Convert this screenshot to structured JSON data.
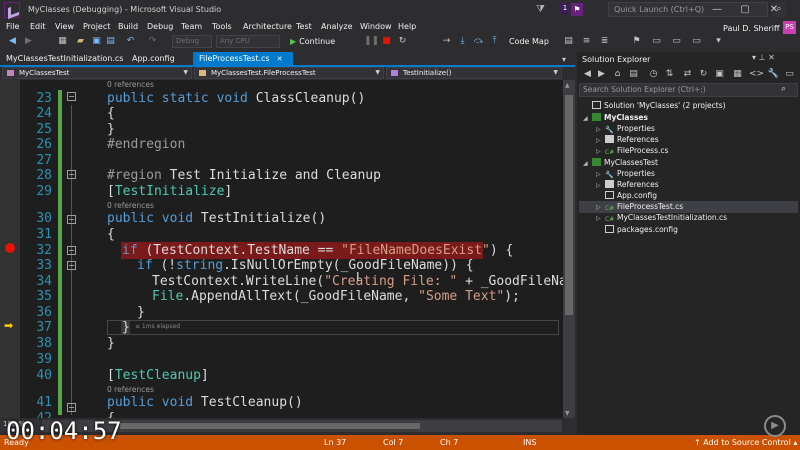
{
  "window": {
    "title": "MyClasses (Debugging) - Microsoft Visual Studio",
    "notification_count": "1",
    "quick_launch_placeholder": "Quick Launch (Ctrl+Q)",
    "user_name": "Paul D. Sheriff",
    "user_initials": "PS"
  },
  "menu": [
    "File",
    "Edit",
    "View",
    "Project",
    "Build",
    "Debug",
    "Team",
    "Tools",
    "Architecture",
    "Test",
    "Analyze",
    "Window",
    "Help"
  ],
  "toolbar": {
    "config_combo": "Debug",
    "platform_combo": "Any CPU",
    "continue_label": "Continue",
    "codemap_label": "Code Map"
  },
  "tabs": [
    {
      "label": "MyClassesTestInitialization.cs"
    },
    {
      "label": "App.config"
    },
    {
      "label": "FileProcessTest.cs",
      "active": true
    }
  ],
  "navbar": {
    "project": "MyClassesTest",
    "class": "MyClassesTest.FileProcessTest",
    "member": "TestInitialize()"
  },
  "editor": {
    "lens_refs": "0 references",
    "elapsed": "≤ 1ms elapsed",
    "line_numbers": [
      "23",
      "24",
      "25",
      "26",
      "27",
      "28",
      "29",
      "30",
      "31",
      "32",
      "33",
      "34",
      "35",
      "36",
      "37",
      "38",
      "39",
      "40",
      "41",
      "42"
    ],
    "lines": {
      "l23": {
        "kw": "public static void ",
        "rest": "ClassCleanup()"
      },
      "l24": "{",
      "l25": "}",
      "l26": "#endregion",
      "l28_kw": "#region",
      "l28_rest": " Test Initialize and Cleanup",
      "l29_open": "[",
      "l29_ty": "TestInitialize",
      "l29_close": "]",
      "l30": {
        "kw": "public void ",
        "rest": "TestInitialize()"
      },
      "l31": "{",
      "l32": {
        "kw": "if",
        "a": " (TestContext.TestName == ",
        "str": "\"FileNameDoesExist\"",
        "b": ") {"
      },
      "l33": {
        "kw": "if",
        "a": " (!",
        "kw2": "string",
        "b": ".IsNullOrEmpty(_GoodFileName)) {"
      },
      "l34": {
        "a": "TestContext.WriteLine(",
        "str": "\"Creating File: \"",
        "b": " + _GoodFileName"
      },
      "l35": {
        "ty": "File",
        "a": ".AppendAllText(_GoodFileName, ",
        "str": "\"Some Text\"",
        "b": ");"
      },
      "l36": "}",
      "l37": "}",
      "l38": "}",
      "l40_open": "[",
      "l40_ty": "TestCleanup",
      "l40_close": "]",
      "l41": {
        "kw": "public void ",
        "rest": "TestCleanup()"
      },
      "l42": "{"
    },
    "zoom": "100 %"
  },
  "solution_explorer": {
    "title": "Solution Explorer",
    "search_placeholder": "Search Solution Explorer (Ctrl+;)",
    "items": [
      {
        "label": "Solution 'MyClasses' (2 projects)",
        "level": 0
      },
      {
        "label": "MyClasses",
        "level": 1,
        "bold": true
      },
      {
        "label": "Properties",
        "level": 2
      },
      {
        "label": "References",
        "level": 2
      },
      {
        "label": "FileProcess.cs",
        "level": 2
      },
      {
        "label": "MyClassesTest",
        "level": 1
      },
      {
        "label": "Properties",
        "level": 2
      },
      {
        "label": "References",
        "level": 2
      },
      {
        "label": "App.config",
        "level": 2
      },
      {
        "label": "FileProcessTest.cs",
        "level": 2,
        "selected": true
      },
      {
        "label": "MyClassesTestInitialization.cs",
        "level": 2
      },
      {
        "label": "packages.config",
        "level": 2
      }
    ]
  },
  "status": {
    "ready": "Ready",
    "ln": "Ln 37",
    "col": "Col 7",
    "ch": "Ch 7",
    "ins": "INS",
    "source_control": "Add to Source Control"
  },
  "overlay": {
    "timer": "00:04:57"
  },
  "colors": {
    "accent": "#007acc",
    "status_bar": "#ca5100",
    "breakpoint": "#e51400",
    "breakpoint_line": "#7a1a1a"
  }
}
